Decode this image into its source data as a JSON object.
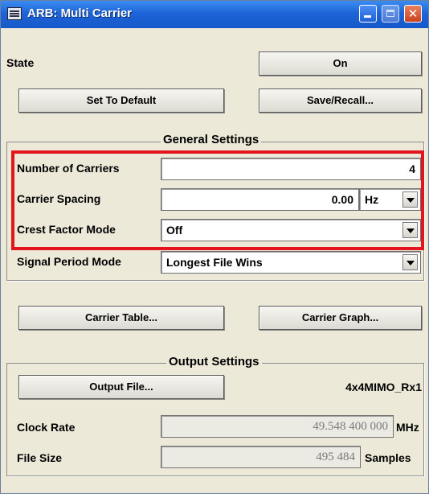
{
  "window": {
    "title": "ARB: Multi Carrier",
    "icon": "panel-icon",
    "controls": [
      "minimize-icon",
      "maximize-icon",
      "close-icon"
    ]
  },
  "state": {
    "label": "State",
    "value": "On"
  },
  "actions": {
    "set_default": "Set To Default",
    "save_recall": "Save/Recall..."
  },
  "general": {
    "title": "General Settings",
    "num_carriers": {
      "label": "Number of Carriers",
      "value": "4"
    },
    "carrier_spacing": {
      "label": "Carrier Spacing",
      "value": "0.00",
      "unit": "Hz"
    },
    "crest_factor": {
      "label": "Crest Factor Mode",
      "value": "Off"
    }
  },
  "signal_period": {
    "label": "Signal Period Mode",
    "value": "Longest File Wins"
  },
  "carrier_buttons": {
    "table": "Carrier Table...",
    "graph": "Carrier Graph..."
  },
  "output": {
    "title": "Output Settings",
    "file_button": "Output File...",
    "file_name": "4x4MIMO_Rx1",
    "clock_rate": {
      "label": "Clock Rate",
      "value": "49.548 400 000",
      "unit": "MHz"
    },
    "file_size": {
      "label": "File Size",
      "value": "495 484",
      "unit": "Samples"
    }
  },
  "colors": {
    "titlebar": "#1e64d8",
    "highlight": "#e3141b",
    "panel": "#ece9d8"
  }
}
